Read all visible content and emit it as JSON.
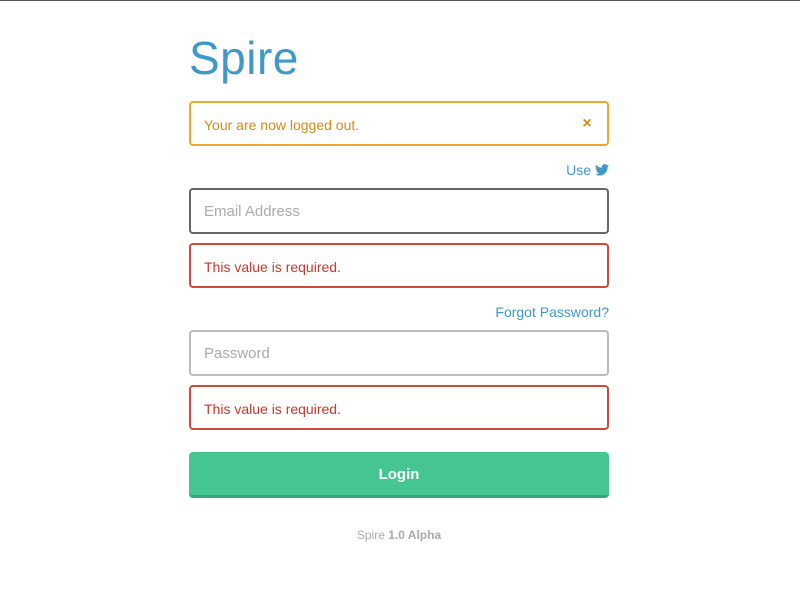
{
  "app": {
    "logo_text": "Spire",
    "brand_color": "#3f98c8"
  },
  "alert": {
    "message": "Your are now logged out.",
    "close_glyph": "×",
    "close_icon": "close-icon",
    "color": "#f0a72f"
  },
  "twitter": {
    "label": "Use",
    "icon": "twitter-icon"
  },
  "email": {
    "placeholder": "Email Address",
    "value": "",
    "error": "This value is required."
  },
  "password": {
    "forgot_link": "Forgot Password?",
    "placeholder": "Password",
    "value": "",
    "error": "This value is required."
  },
  "login": {
    "button_label": "Login",
    "color": "#45c592"
  },
  "footer": {
    "product": "Spire",
    "version": "1.0 Alpha"
  },
  "colors": {
    "error": "#cf4a3c",
    "link": "#3f98c8"
  }
}
